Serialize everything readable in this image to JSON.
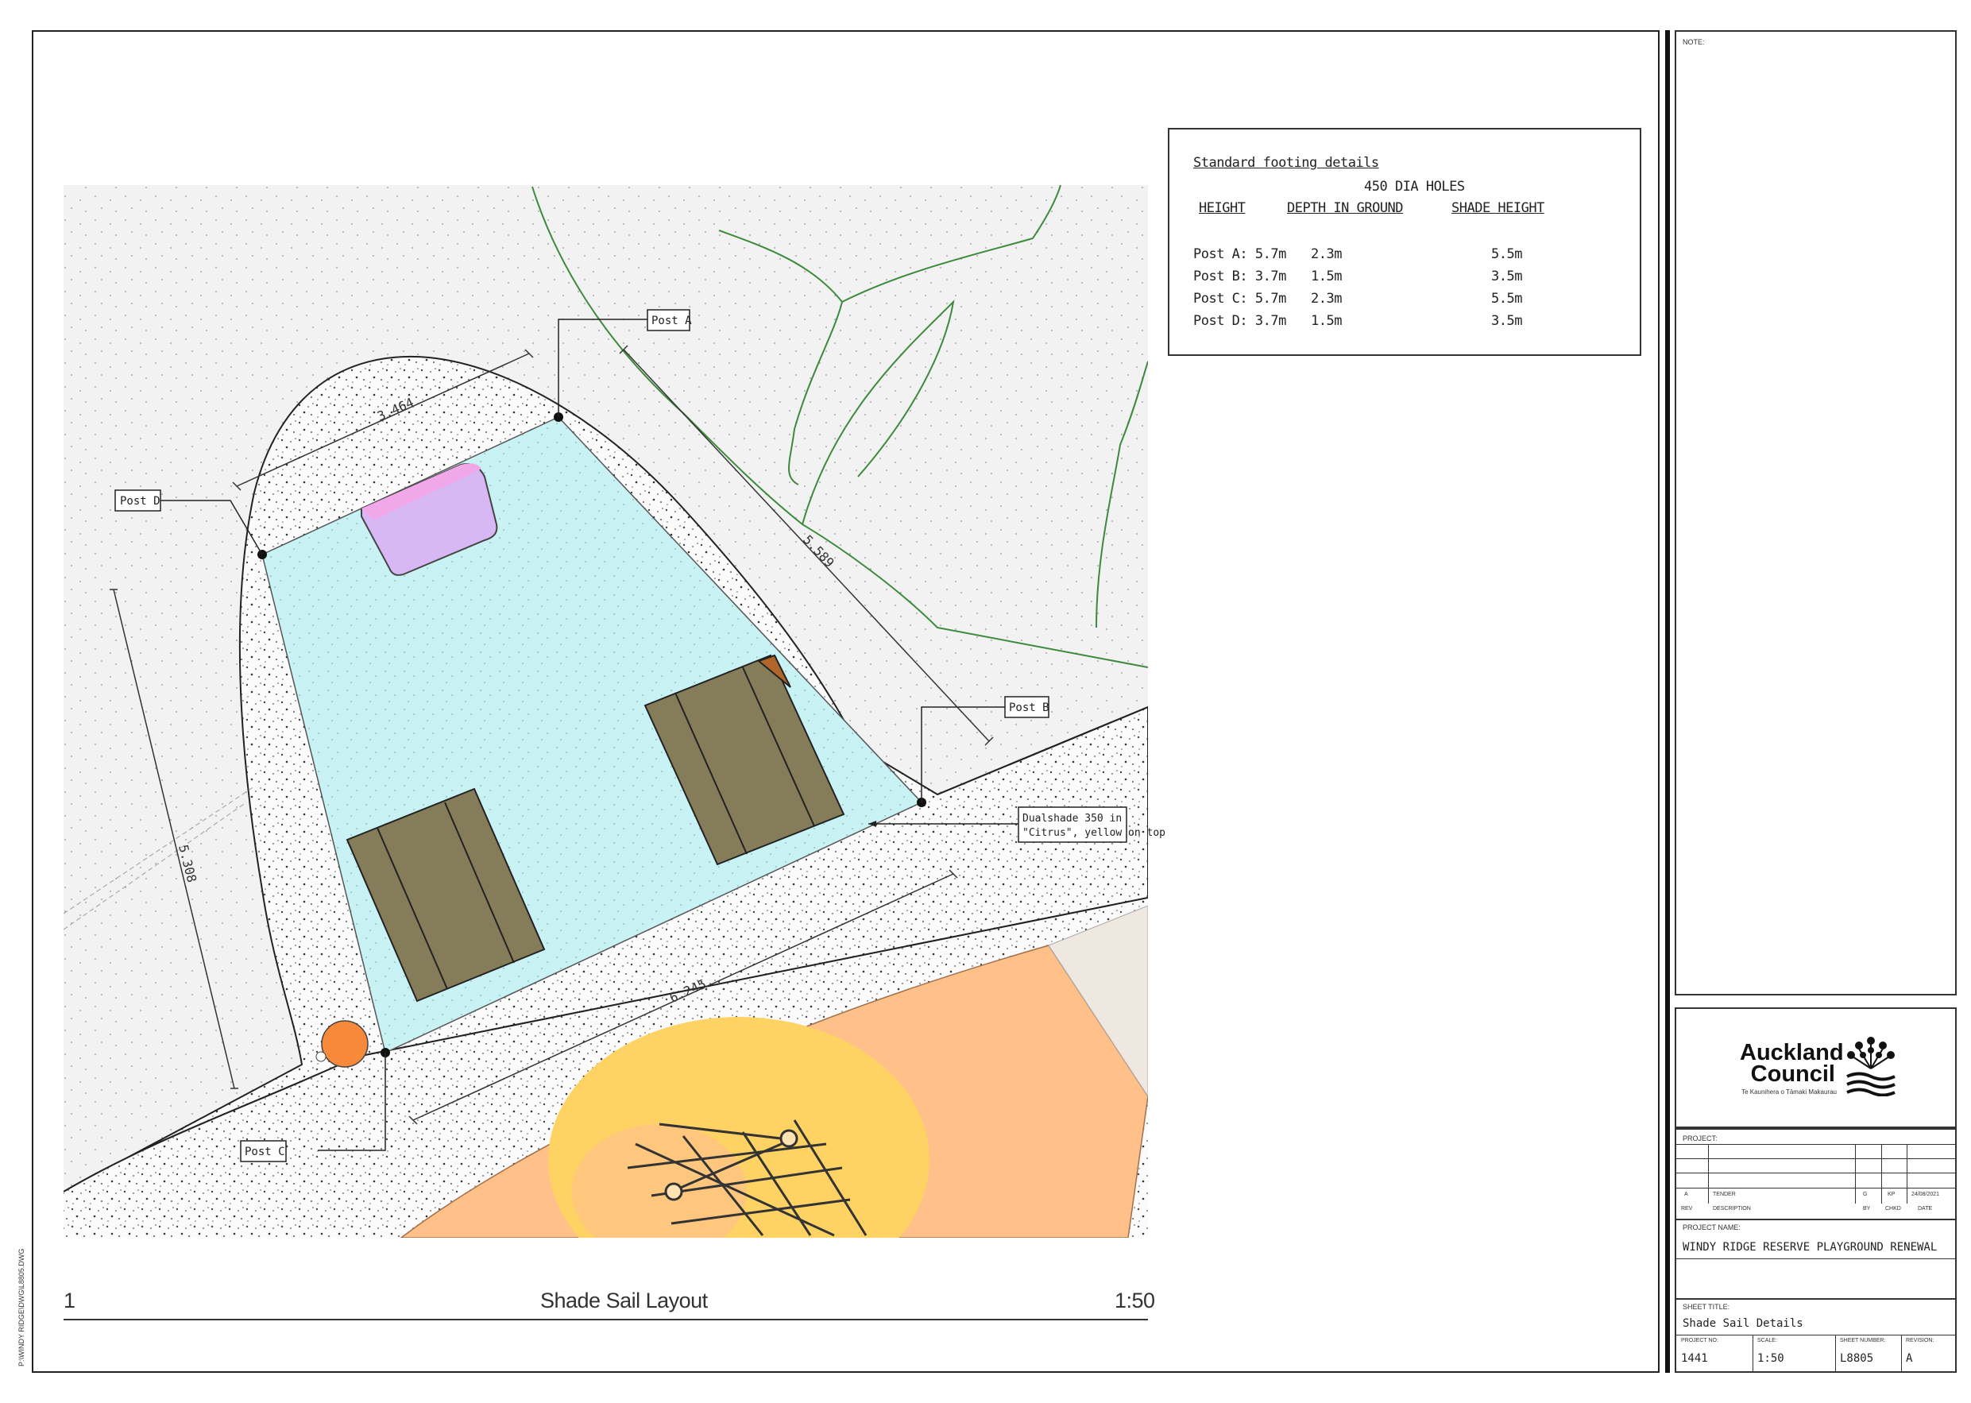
{
  "drawing": {
    "view_number": "1",
    "view_title": "Shade Sail Layout",
    "view_scale": "1:50",
    "labels": {
      "post_a": "Post A",
      "post_b": "Post B",
      "post_c": "Post C",
      "post_d": "Post D",
      "product_line1": "Dualshade 350 in",
      "product_line2": "\"Citrus\", yellow on top"
    },
    "dimensions": {
      "d1": "3.464",
      "d2": "5.589",
      "d3": "5.308",
      "d4": "6.245"
    },
    "colors": {
      "sail": "#c9f2f4",
      "mulch_bg": "#f1f1f1",
      "path": "#f4f4f4",
      "bench": "#857d5a",
      "play_orange": "#ffc08a",
      "play_yellow": "#ffd363",
      "contour": "#3d8a3d",
      "purple": "#d7b8f4",
      "ball": "#f6893a"
    }
  },
  "footing": {
    "title": "Standard footing details",
    "subtitle": "450 DIA HOLES",
    "headers": [
      "HEIGHT",
      "DEPTH IN GROUND",
      "SHADE HEIGHT"
    ],
    "rows": [
      [
        "Post A: 5.7m",
        "2.3m",
        "5.5m"
      ],
      [
        "Post B: 3.7m",
        "1.5m",
        "3.5m"
      ],
      [
        "Post C: 5.7m",
        "2.3m",
        "5.5m"
      ],
      [
        "Post D: 3.7m",
        "1.5m",
        "3.5m"
      ]
    ]
  },
  "side": {
    "note_label": "NOTE:",
    "logo_line1": "Auckland",
    "logo_line2": "Council",
    "logo_sub": "Te Kaunihera o Tāmaki Makaurau",
    "project_label": "PROJECT:",
    "rev_row": [
      "A",
      "TENDER",
      "G",
      "KP",
      "24/08/2021"
    ],
    "rev_header": [
      "REV",
      "DESCRIPTION",
      "BY",
      "CHKD",
      "DATE"
    ],
    "project_name_label": "PROJECT NAME:",
    "project_name": "WINDY RIDGE RESERVE PLAYGROUND RENEWAL",
    "sheet_title_label": "SHEET TITLE:",
    "sheet_title": "Shade Sail Details",
    "project_no_label": "PROJECT NO:",
    "project_no": "1441",
    "scale_label": "SCALE:",
    "scale": "1:50",
    "sheet_no_label": "SHEET NUMBER:",
    "sheet_no": "L8805",
    "revision_label": "REVISION:",
    "revision": "A"
  },
  "vertical_text": "P:\\WINDY RIDGE\\DWG\\L8805.DWG"
}
